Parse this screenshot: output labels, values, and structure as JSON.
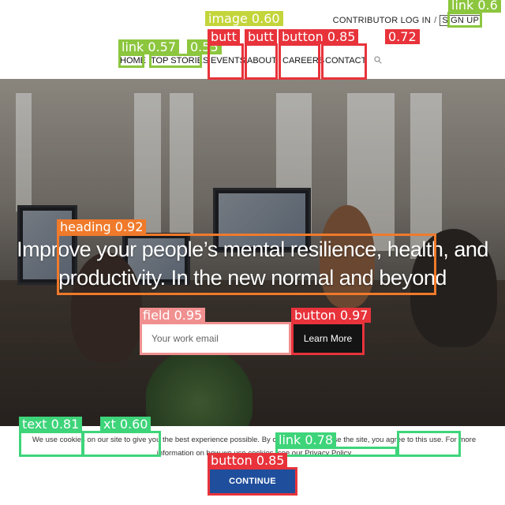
{
  "header": {
    "contributor_login": "CONTRIBUTOR LOG IN",
    "separator": "/",
    "sign_up": "SIGN UP",
    "nav": [
      "HOME",
      "TOP STORIES",
      "EVENTS",
      "ABOUT",
      "CAREERS",
      "CONTACT"
    ],
    "search_icon": "search-icon"
  },
  "hero": {
    "heading": "Improve your people’s mental resilience, health, and productivity. In the new normal and beyond",
    "email_placeholder": "Your work email",
    "learn_more": "Learn More"
  },
  "cookie": {
    "text_before": "We use cookies on our site to give you the best experience possible. By continuing to browse the site, you agree to this use. For more information on how we use cookies, see our ",
    "privacy_link": "Privacy Policy",
    "continue": "CONTINUE"
  },
  "annotations": {
    "image": "image  0.60",
    "link_signup": "link  0.6",
    "link_home": "link  0.57",
    "link_topstories": "0.55",
    "button_events": "butt",
    "button_about": "butt",
    "button_careers": "button  0.85",
    "button_contact": "0.72",
    "heading": "heading  0.92",
    "field": "field  0.95",
    "button_learn": "button  0.97",
    "text1": "text  0.81",
    "text2": "xt  0.60",
    "link_privacy": "link  0.78",
    "button_continue": "button  0.85"
  }
}
